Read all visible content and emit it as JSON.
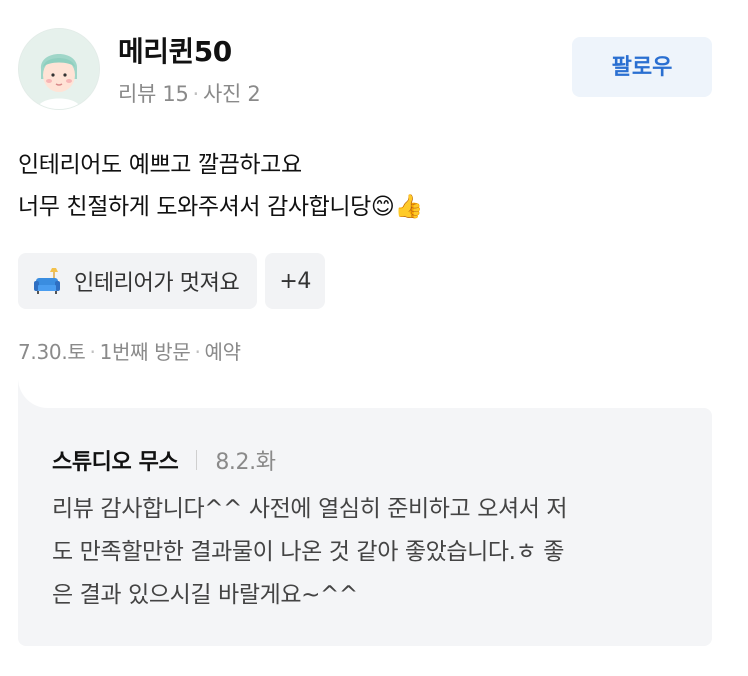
{
  "reviewer": {
    "name": "메리퀸50",
    "stats": {
      "reviews": "리뷰 15",
      "photos": "사진 2"
    }
  },
  "follow_label": "팔로우",
  "review": {
    "lines": [
      "인테리어도 예쁘고 깔끔하고요",
      "너무 친절하게 도와주셔서 감사합니당😊👍"
    ]
  },
  "tags": {
    "primary": {
      "icon": "sofa-icon",
      "label": "인테리어가 멋져요"
    },
    "more": "+4"
  },
  "visit": {
    "date": "7.30.토",
    "count": "1번째 방문",
    "type": "예약"
  },
  "reply": {
    "author": "스튜디오 무스",
    "date": "8.2.화",
    "lines": [
      "리뷰 감사합니다^^ 사전에 열심히 준비하고 오셔서 저",
      "도 만족할만한 결과물이 나온 것 같아 좋았습니다.ㅎ 좋",
      "은 결과 있으시길 바랄게요~^^"
    ]
  },
  "colors": {
    "accent": "#2a6fd1",
    "follow_bg": "#eef4fb",
    "muted": "#8a8a8a",
    "reply_bg": "#f4f5f7"
  }
}
